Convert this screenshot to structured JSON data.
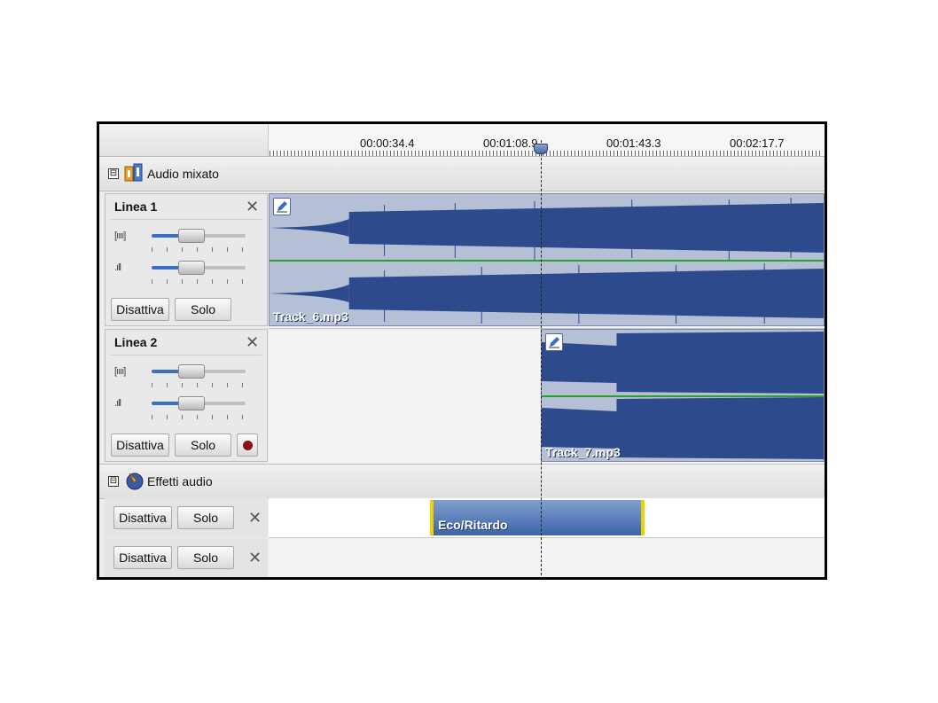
{
  "ruler": {
    "ticks": [
      "00:00:34.4",
      "00:01:08.9",
      "00:01:43.3",
      "00:02:17.7"
    ]
  },
  "groups": {
    "audio": {
      "label": "Audio mixato",
      "toggle": "⊟"
    },
    "effects": {
      "label": "Effetti audio",
      "toggle": "⊟"
    }
  },
  "tracks": [
    {
      "name": "Linea 1",
      "close": "✕",
      "mute_label": "Disattiva",
      "solo_label": "Solo",
      "volume_icon": "[ıııı]",
      "pan_icon": ".ıll",
      "clip": "Track_6.mp3"
    },
    {
      "name": "Linea 2",
      "close": "✕",
      "mute_label": "Disattiva",
      "solo_label": "Solo",
      "volume_icon": "[ıııı]",
      "pan_icon": ".ıll",
      "clip": "Track_7.mp3"
    }
  ],
  "effect_rows": [
    {
      "mute_label": "Disattiva",
      "solo_label": "Solo",
      "close": "✕",
      "effect": "Eco/Ritardo"
    },
    {
      "mute_label": "Disattiva",
      "solo_label": "Solo",
      "close": "✕"
    }
  ],
  "colors": {
    "wave": "#2d4a8c",
    "clip_bg": "#b5bfd6",
    "center_line": "#2aa02a",
    "fx_border": "#f2d000",
    "record": "#8c0f0f"
  },
  "icons": {
    "audio_group": "audio-mix-icon",
    "effects_group": "effects-icon",
    "volume": "volume-icon",
    "pan": "pan-icon",
    "edit": "edit-clip-icon",
    "record": "record-icon"
  }
}
